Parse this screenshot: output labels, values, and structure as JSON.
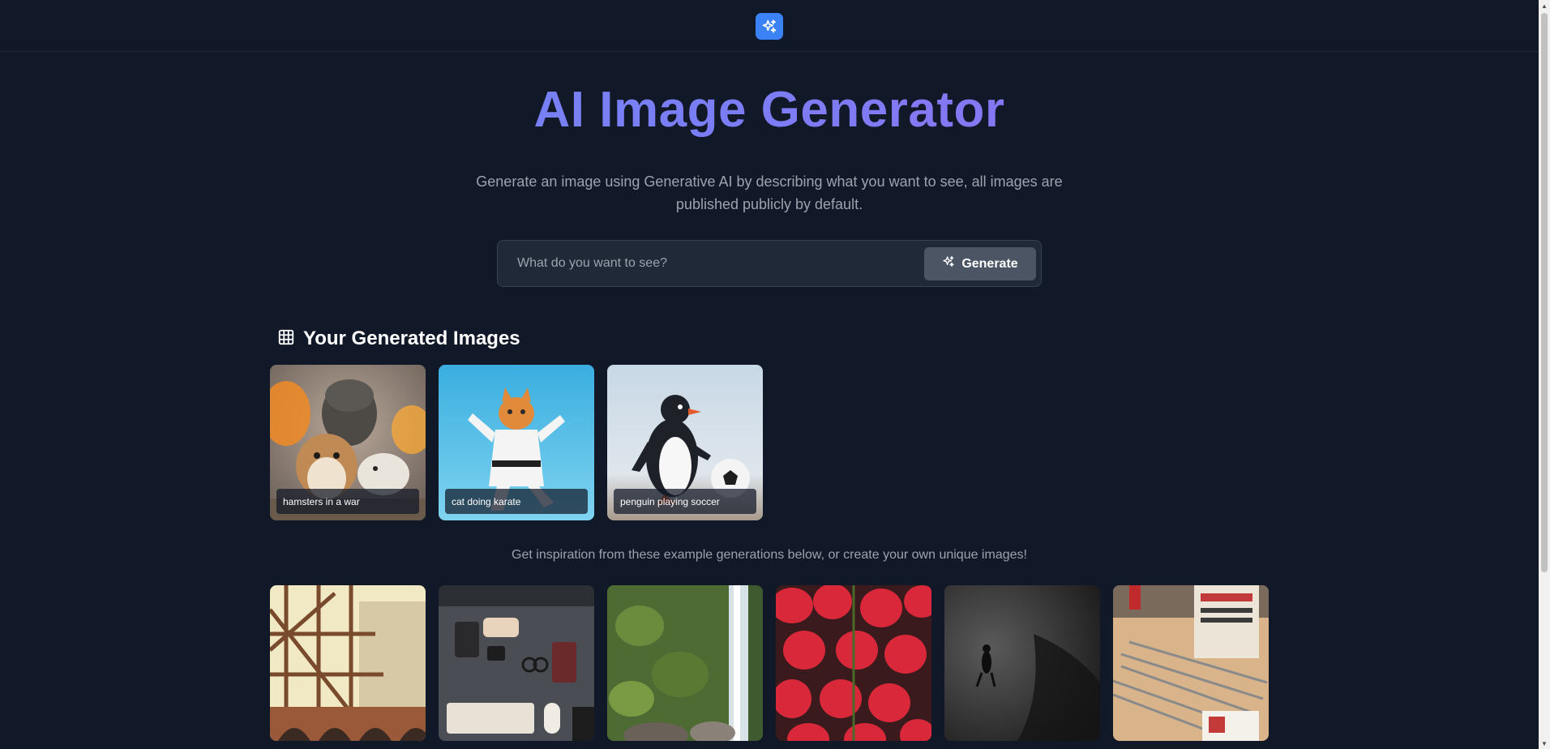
{
  "header": {
    "logo_icon": "sparkles-icon"
  },
  "hero": {
    "title": "AI Image Generator",
    "subtitle": "Generate an image using Generative AI by describing what you want to see, all images are published publicly by default."
  },
  "prompt": {
    "placeholder": "What do you want to see?",
    "value": "",
    "generate_label": "Generate"
  },
  "generated": {
    "heading": "Your Generated Images",
    "heading_icon": "grid-icon",
    "items": [
      {
        "caption": "hamsters in a war"
      },
      {
        "caption": "cat doing karate"
      },
      {
        "caption": "penguin playing soccer"
      }
    ]
  },
  "examples": {
    "text": "Get inspiration from these example generations below, or create your own unique images!",
    "items": [
      {
        "subject": "building-structure"
      },
      {
        "subject": "desk-workspace"
      },
      {
        "subject": "waterfall"
      },
      {
        "subject": "strawberries"
      },
      {
        "subject": "diver"
      },
      {
        "subject": "pencils-table"
      }
    ]
  },
  "colors": {
    "background": "#111827",
    "accent": "#3b82f6",
    "title_gradient_start": "#6b8cf6",
    "title_gradient_end": "#9b6cf0"
  }
}
